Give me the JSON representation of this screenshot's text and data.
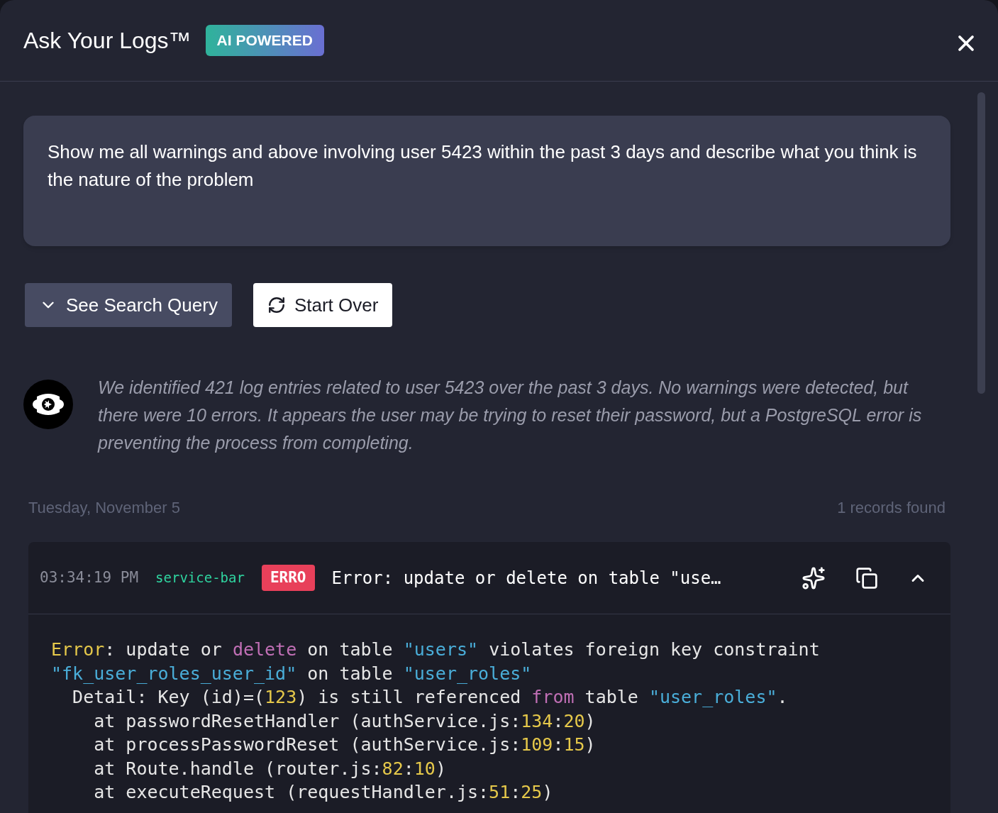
{
  "header": {
    "title": "Ask Your Logs™",
    "badge": "AI POWERED"
  },
  "prompt": {
    "value": "Show me all warnings and above involving user 5423 within the past 3 days and describe what you think is the nature of the problem"
  },
  "actions": [
    {
      "label": "See Search Query",
      "kind": "secondary"
    },
    {
      "label": "Start Over",
      "kind": "primary"
    }
  ],
  "summary": "We identified 421 log entries related to user 5423 over the past 3 days. No warnings were detected, but there were 10 errors. It appears the user may be trying to reset their password, but a PostgreSQL error is preventing the process from completing.",
  "day": {
    "date": "Tuesday, November 5",
    "count": "1 records found"
  },
  "log": {
    "time": "03:34:19 PM",
    "service": "service-bar",
    "level": "ERRO",
    "message": "Error: update or delete on table \"use…",
    "expanded": true,
    "lines": [
      [
        {
          "t": "Error",
          "kind": "label"
        },
        {
          "t": ": update or ",
          "kind": "plain"
        },
        {
          "t": "delete",
          "kind": "keyword"
        },
        {
          "t": " on table ",
          "kind": "plain"
        },
        {
          "t": "\"users\"",
          "kind": "string"
        },
        {
          "t": " violates foreign key constraint",
          "kind": "plain"
        }
      ],
      [
        {
          "t": "\"fk_user_roles_user_id\"",
          "kind": "string"
        },
        {
          "t": " on table ",
          "kind": "plain"
        },
        {
          "t": "\"user_roles\"",
          "kind": "string"
        }
      ],
      [
        {
          "t": "  Detail: Key (id)=(",
          "kind": "plain"
        },
        {
          "t": "123",
          "kind": "number"
        },
        {
          "t": ") is still referenced ",
          "kind": "plain"
        },
        {
          "t": "from",
          "kind": "keyword"
        },
        {
          "t": " table ",
          "kind": "plain"
        },
        {
          "t": "\"user_roles\"",
          "kind": "string"
        },
        {
          "t": ".",
          "kind": "plain"
        }
      ],
      [
        {
          "t": "    at passwordResetHandler (authService.js:",
          "kind": "plain"
        },
        {
          "t": "134",
          "kind": "number"
        },
        {
          "t": ":",
          "kind": "plain"
        },
        {
          "t": "20",
          "kind": "number"
        },
        {
          "t": ")",
          "kind": "plain"
        }
      ],
      [
        {
          "t": "    at processPasswordReset (authService.js:",
          "kind": "plain"
        },
        {
          "t": "109",
          "kind": "number"
        },
        {
          "t": ":",
          "kind": "plain"
        },
        {
          "t": "15",
          "kind": "number"
        },
        {
          "t": ")",
          "kind": "plain"
        }
      ],
      [
        {
          "t": "    at Route.handle (router.js:",
          "kind": "plain"
        },
        {
          "t": "82",
          "kind": "number"
        },
        {
          "t": ":",
          "kind": "plain"
        },
        {
          "t": "10",
          "kind": "number"
        },
        {
          "t": ")",
          "kind": "plain"
        }
      ],
      [
        {
          "t": "    at executeRequest (requestHandler.js:",
          "kind": "plain"
        },
        {
          "t": "51",
          "kind": "number"
        },
        {
          "t": ":",
          "kind": "plain"
        },
        {
          "t": "25",
          "kind": "number"
        },
        {
          "t": ")",
          "kind": "plain"
        }
      ]
    ]
  }
}
